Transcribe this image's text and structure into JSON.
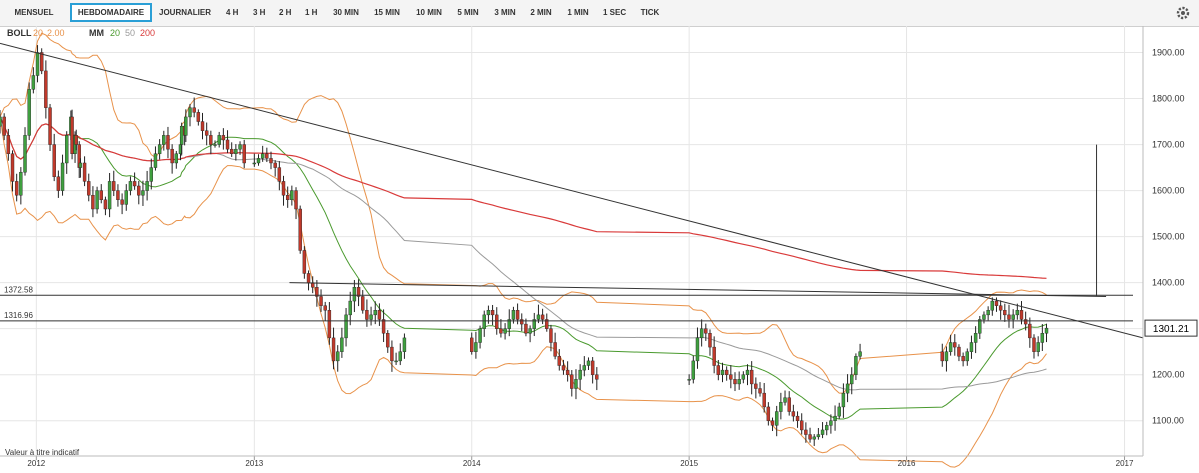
{
  "toolbar": {
    "timeframes": [
      "MENSUEL",
      "HEBDOMADAIRE",
      "JOURNALIER",
      "4 H",
      "3 H",
      "2 H",
      "1 H",
      "30 MIN",
      "15 MIN",
      "10 MIN",
      "5 MIN",
      "3 MIN",
      "2 MIN",
      "1 MIN",
      "1 SEC",
      "TICK"
    ],
    "active": "HEBDOMADAIRE",
    "settings_icon": "gear-icon"
  },
  "legend": {
    "boll": {
      "label": "BOLL",
      "period": "20",
      "dev": "2.00"
    },
    "mm": {
      "label": "MM",
      "p1": "20",
      "p2": "50",
      "p3": "200"
    }
  },
  "footer_note": "Valeur à titre indicatif",
  "price_label": "1301.21",
  "colors": {
    "up": "#3f9f3f",
    "down": "#c0392b",
    "boll": "#e8924a",
    "mm20": "#4a9a2e",
    "mm50": "#9a9a9a",
    "mm200": "#d93a3a",
    "lines": "#333333",
    "accent": "#2a9fd6",
    "grid": "#e6e6e6"
  },
  "chart_data": {
    "type": "candlestick",
    "x_axis": {
      "type": "time",
      "range": [
        "2011-11",
        "2017-02"
      ],
      "ticks": [
        "2012",
        "2013",
        "2014",
        "2015",
        "2016",
        "2017"
      ]
    },
    "y_axis": {
      "ylim": [
        1040,
        1945
      ],
      "ticks": [
        1100,
        1200,
        1300,
        1400,
        1500,
        1600,
        1700,
        1800,
        1900
      ],
      "tick_labels": [
        "1100.00",
        "1200.00",
        "1300.00",
        "1400.00",
        "1500.00",
        "1600.00",
        "1700.00",
        "1800.00",
        "1900.00"
      ],
      "position": "right"
    },
    "grid": true,
    "candles_weekly_close": [
      {
        "t": "2011-11",
        "v": [
          1760,
          1720,
          1680,
          1620,
          1590,
          1640,
          1720,
          1820,
          1850,
          1900,
          1860,
          1780,
          1700,
          1630,
          1600,
          1660,
          1720,
          1760,
          1720,
          1650
        ]
      },
      {
        "t": "2012-03",
        "v": [
          1680,
          1700,
          1660,
          1620,
          1590,
          1560,
          1600,
          1580,
          1560,
          1620,
          1600,
          1580,
          1570,
          1600,
          1620,
          1610,
          1590,
          1600,
          1620,
          1650,
          1680,
          1700,
          1720,
          1690,
          1660,
          1680,
          1700,
          1720
        ]
      },
      {
        "t": "2012-09",
        "v": [
          1740,
          1760,
          1780,
          1770,
          1750,
          1730,
          1720,
          1700,
          1700,
          1720,
          1710,
          1690,
          1680,
          1690,
          1700,
          1660
        ]
      },
      {
        "t": "2013-01",
        "v": [
          1660,
          1670,
          1680,
          1670,
          1660,
          1650,
          1620,
          1590,
          1580,
          1600,
          1560,
          1470,
          1420,
          1400,
          1390,
          1370,
          1350,
          1340,
          1280,
          1230,
          1250,
          1280,
          1330,
          1360,
          1390,
          1370,
          1340,
          1320,
          1330,
          1340,
          1320,
          1290,
          1260,
          1230,
          1230,
          1250,
          1280
        ]
      },
      {
        "t": "2014-01",
        "v": [
          1250,
          1270,
          1300,
          1330,
          1340,
          1330,
          1300,
          1290,
          1300,
          1320,
          1340,
          1320,
          1310,
          1290,
          1300,
          1320,
          1330,
          1320,
          1300,
          1270,
          1240,
          1220,
          1210,
          1200,
          1170,
          1190,
          1210,
          1220,
          1230,
          1200,
          1190
        ]
      },
      {
        "t": "2015-01",
        "v": [
          1190,
          1230,
          1280,
          1300,
          1290,
          1260,
          1220,
          1200,
          1210,
          1200,
          1190,
          1180,
          1190,
          1200,
          1210,
          1180,
          1170,
          1160,
          1130,
          1100,
          1090,
          1120,
          1140,
          1150,
          1120,
          1110,
          1100,
          1080,
          1070,
          1060,
          1065,
          1070,
          1080,
          1090,
          1100,
          1110,
          1130,
          1160,
          1180,
          1200,
          1240,
          1250
        ]
      },
      {
        "t": "2016-03",
        "v": [
          1230,
          1250,
          1270,
          1260,
          1240,
          1230,
          1250,
          1270,
          1290,
          1320,
          1330,
          1340,
          1360,
          1350,
          1340,
          1330,
          1320,
          1330,
          1340,
          1320,
          1310,
          1280,
          1250,
          1270,
          1290,
          1301.21
        ]
      }
    ],
    "overlays": [
      {
        "name": "BOLL 20 2.00",
        "type": "bollinger",
        "period": 20,
        "dev": 2.0
      },
      {
        "name": "MM 20",
        "type": "sma",
        "period": 20
      },
      {
        "name": "MM 50",
        "type": "sma",
        "period": 50
      },
      {
        "name": "MM 200",
        "type": "sma",
        "period": 200
      }
    ],
    "horizontal_lines": [
      {
        "value": 1372.58,
        "label": "1372.58"
      },
      {
        "value": 1316.96,
        "label": "1316.96"
      }
    ],
    "trendlines": [
      {
        "from": {
          "t": "2011-11",
          "y": 1920
        },
        "to": {
          "t": "2017-02",
          "y": 1280
        }
      },
      {
        "from": {
          "t": "2013-03",
          "y": 1400
        },
        "to": {
          "t": "2016-12",
          "y": 1370
        }
      }
    ],
    "current_price": 1301.21
  }
}
